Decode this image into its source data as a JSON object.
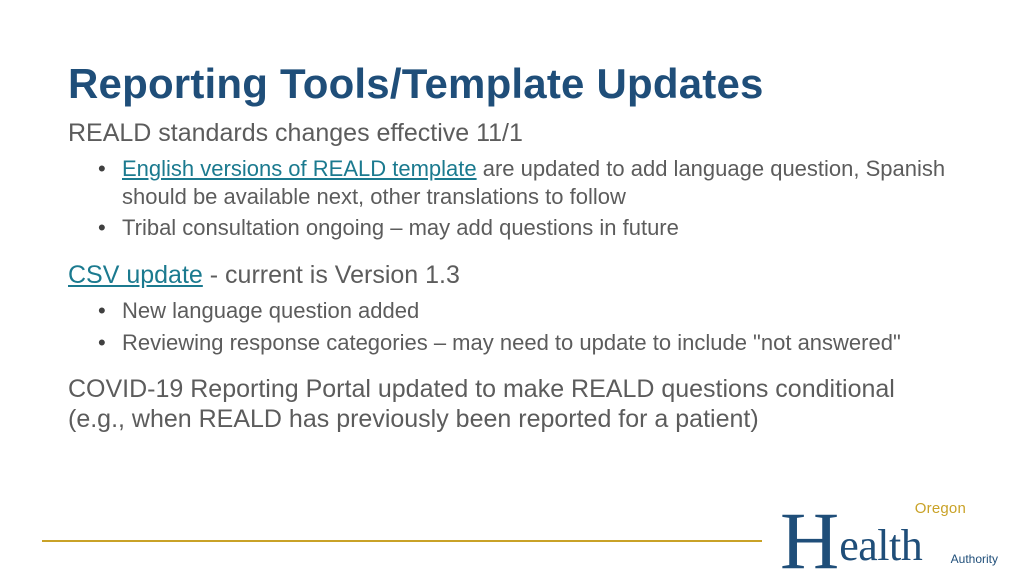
{
  "title": "Reporting Tools/Template Updates",
  "section1": {
    "lead": "REALD standards changes effective 11/1",
    "bullets": [
      {
        "link": "English versions of REALD template",
        "rest": " are updated to add language question, Spanish should be available next, other translations to follow"
      },
      {
        "text": "Tribal consultation ongoing – may add questions in future"
      }
    ]
  },
  "section2": {
    "link": "CSV update",
    "lead_rest": " - current is Version 1.3",
    "bullets": [
      {
        "text": "New language question added"
      },
      {
        "text": "Reviewing response categories – may need to update to include \"not answered\""
      }
    ]
  },
  "section3": {
    "para": "COVID-19 Reporting Portal updated to make REALD questions conditional (e.g., when REALD has previously been reported for a patient)"
  },
  "logo": {
    "top": "Oregon",
    "main": "Health",
    "sub": "Authority"
  }
}
